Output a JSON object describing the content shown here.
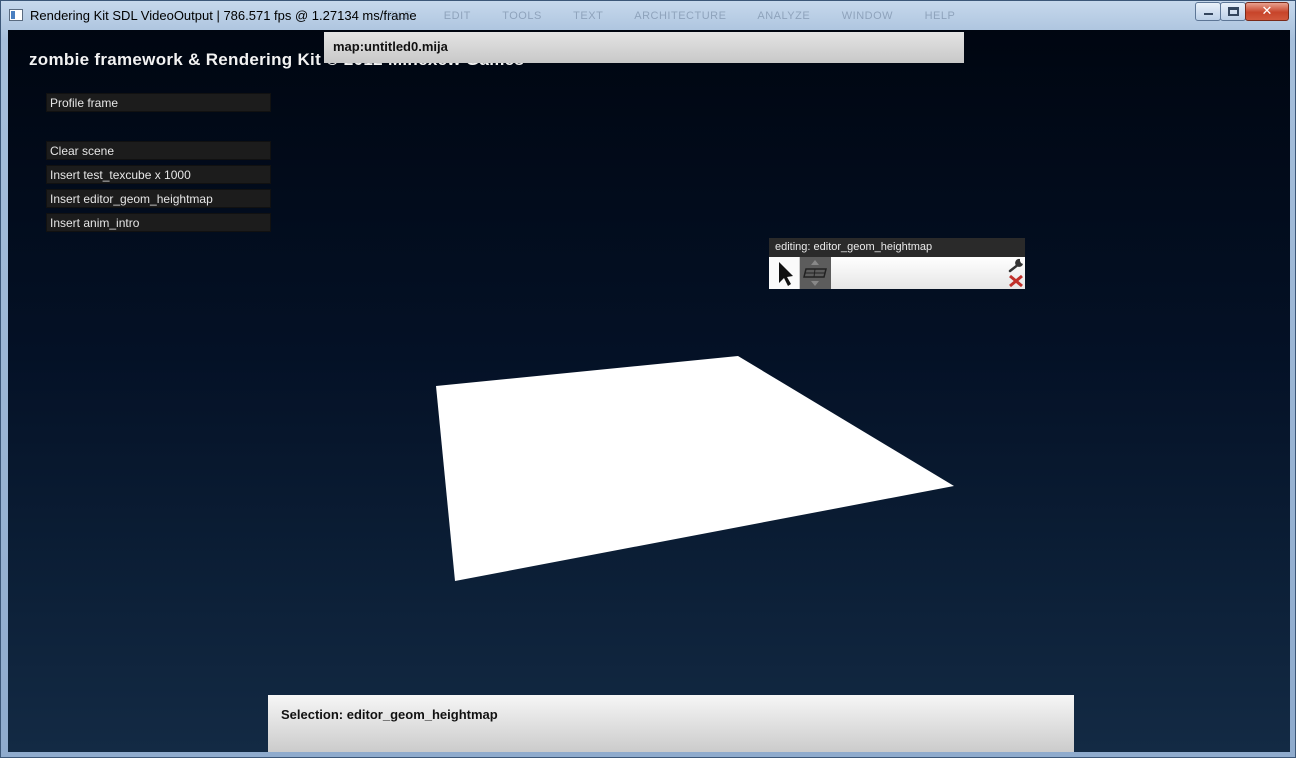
{
  "window": {
    "title": "Rendering Kit SDL VideoOutput | 786.571 fps @ 1.27134 ms/frame",
    "ghost_menu": [
      "FILE",
      "EDIT",
      "TOOLS",
      "TEXT",
      "ARCHITECTURE",
      "ANALYZE",
      "WINDOW",
      "HELP"
    ],
    "minimize_icon": "minimize-icon",
    "maximize_icon": "maximize-icon",
    "close_icon": "close-icon",
    "close_glyph": "✕"
  },
  "header": {
    "text": "zombie framework & Rendering Kit © 2012 Minexew Games"
  },
  "map_bar": {
    "label": "map:untitled0.mija"
  },
  "side_menu": {
    "items": [
      {
        "label": "Profile frame"
      },
      {
        "label": "Clear scene"
      },
      {
        "label": "Insert test_texcube x 1000"
      },
      {
        "label": "Insert editor_geom_heightmap"
      },
      {
        "label": "Insert anim_intro"
      }
    ]
  },
  "edit_panel": {
    "title": "editing: editor_geom_heightmap",
    "tools": [
      "cursor-arrow-icon",
      "pan-move-icon",
      "wrench-icon",
      "close-x-icon"
    ]
  },
  "status": {
    "selection": "Selection: editor_geom_heightmap"
  },
  "colors": {
    "viewport_top": "#000611",
    "viewport_bottom": "#132a44",
    "plane": "#ffffff",
    "close_red": "#c7442a"
  }
}
